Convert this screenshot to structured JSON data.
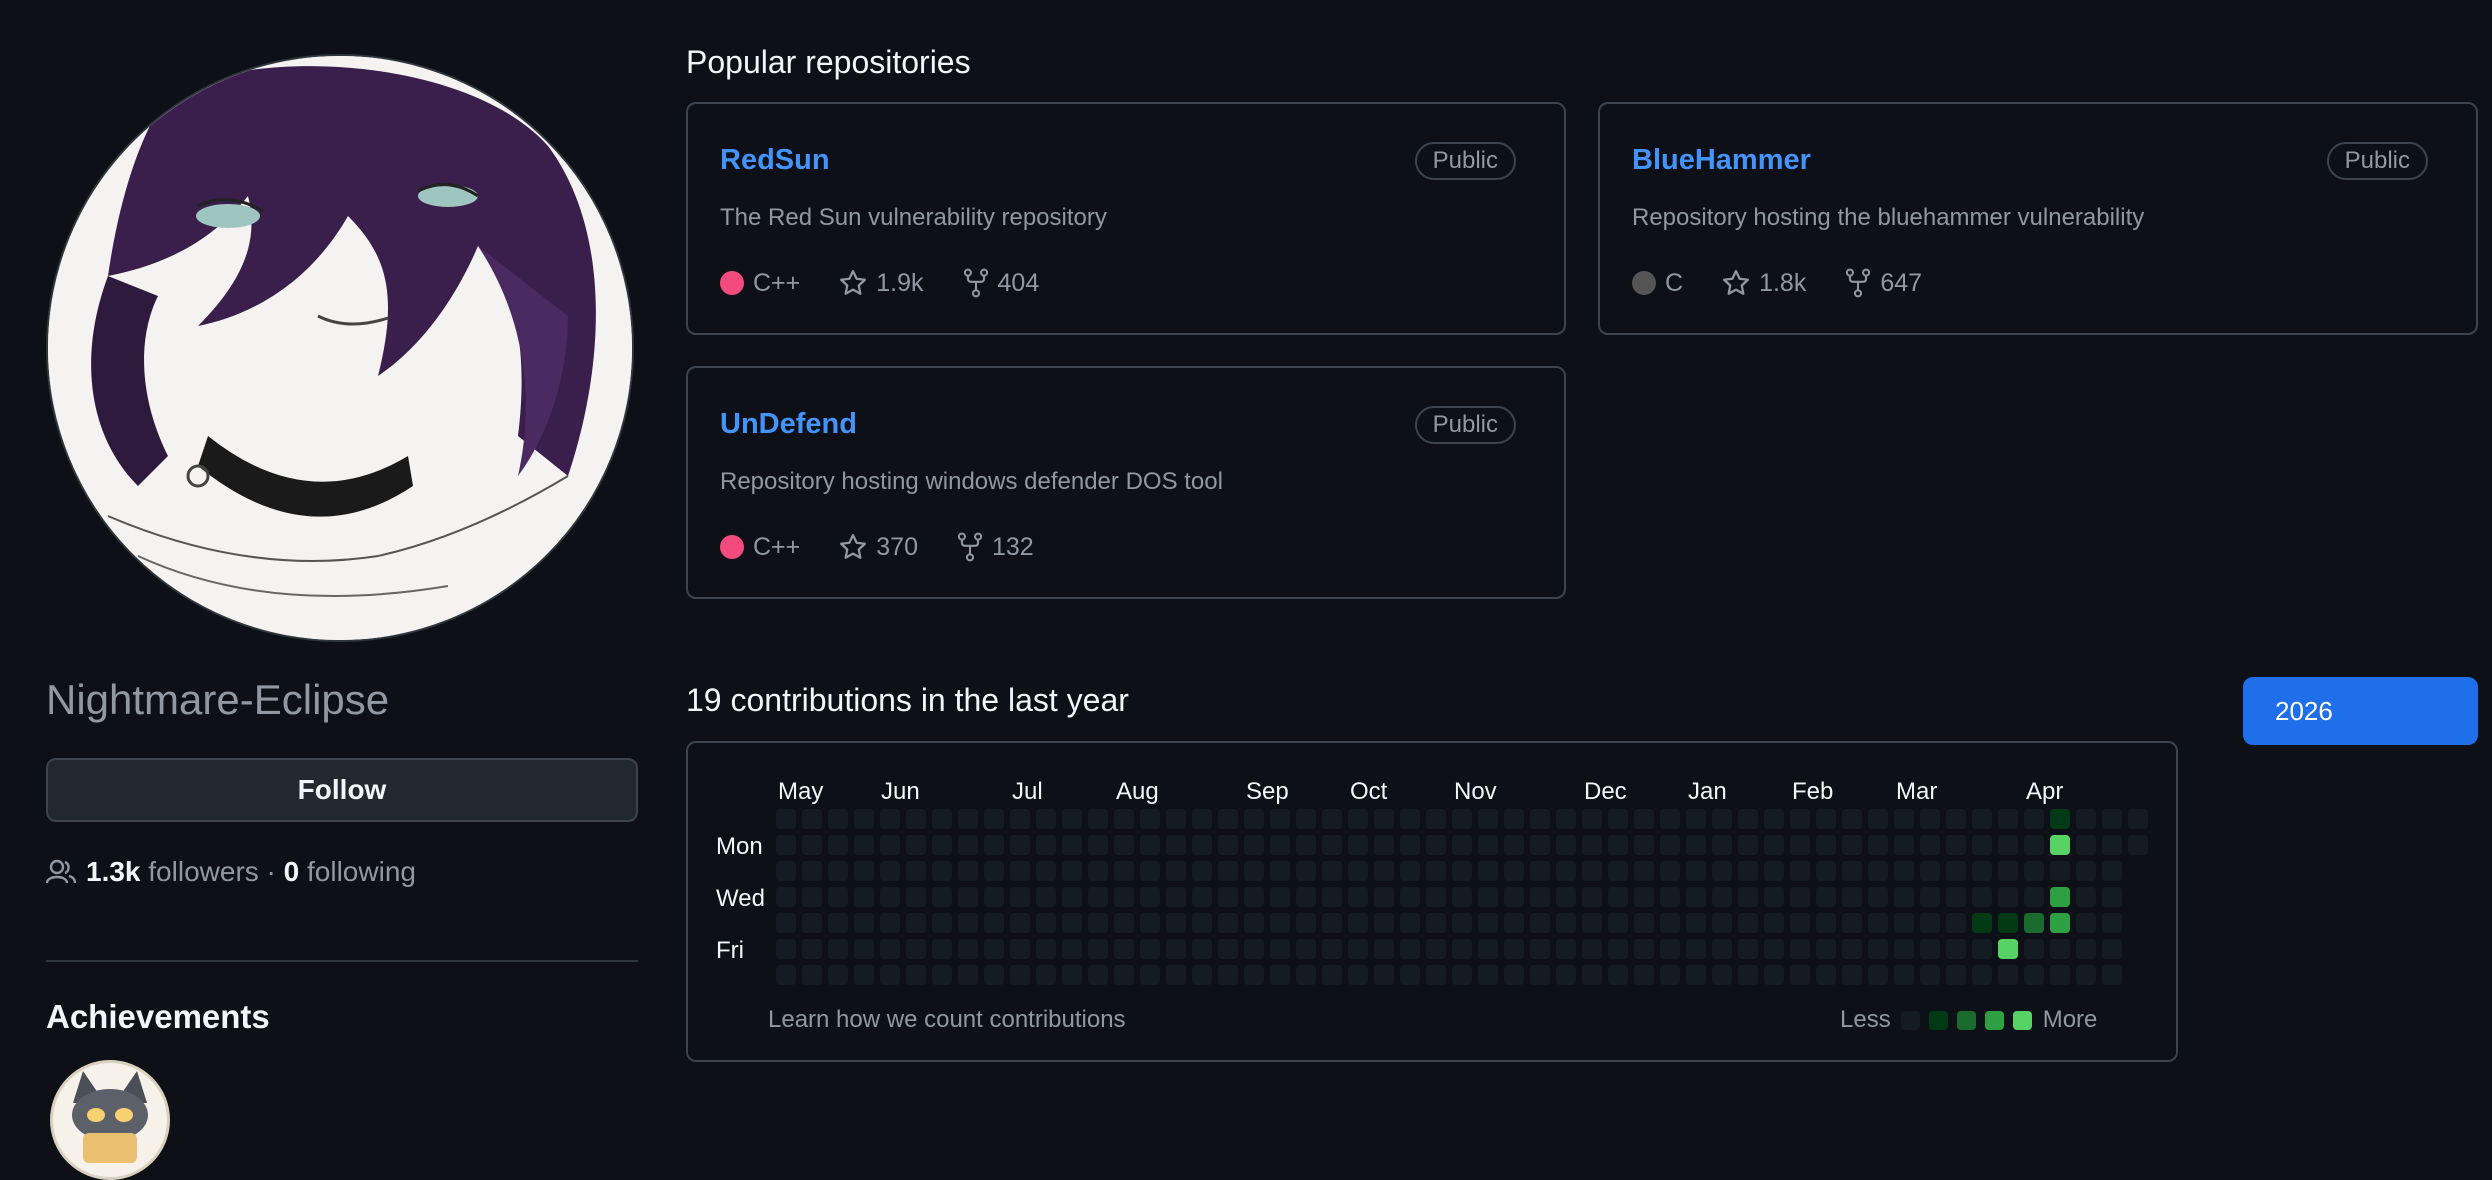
{
  "profile": {
    "display_name": "Nightmare-Eclipse",
    "follow_label": "Follow",
    "followers_count": "1.3k",
    "followers_label": "followers",
    "separator": "·",
    "following_count": "0",
    "following_label": "following",
    "achievements_title": "Achievements"
  },
  "popular": {
    "title": "Popular repositories",
    "repos": [
      {
        "name": "RedSun",
        "visibility": "Public",
        "description": "The Red Sun vulnerability repository",
        "language": "C++",
        "language_color": "#f34b7d",
        "stars": "1.9k",
        "forks": "404"
      },
      {
        "name": "BlueHammer",
        "visibility": "Public",
        "description": "Repository hosting the bluehammer vulnerability",
        "language": "C",
        "language_color": "#555555",
        "stars": "1.8k",
        "forks": "647"
      },
      {
        "name": "UnDefend",
        "visibility": "Public",
        "description": "Repository hosting windows defender DOS tool",
        "language": "C++",
        "language_color": "#f34b7d",
        "stars": "370",
        "forks": "132"
      }
    ]
  },
  "contributions": {
    "title": "19 contributions in the last year",
    "year_button": "2026",
    "months": [
      "May",
      "Jun",
      "Jul",
      "Aug",
      "Sep",
      "Oct",
      "Nov",
      "Dec",
      "Jan",
      "Feb",
      "Mar",
      "Apr"
    ],
    "days": [
      "Mon",
      "Wed",
      "Fri"
    ],
    "weeks": 53,
    "active_cells": [
      {
        "week": 49,
        "day": 0,
        "level": 1
      },
      {
        "week": 49,
        "day": 1,
        "level": 4
      },
      {
        "week": 49,
        "day": 3,
        "level": 3
      },
      {
        "week": 46,
        "day": 4,
        "level": 1
      },
      {
        "week": 47,
        "day": 4,
        "level": 1
      },
      {
        "week": 48,
        "day": 4,
        "level": 2
      },
      {
        "week": 49,
        "day": 4,
        "level": 3
      },
      {
        "week": 47,
        "day": 5,
        "level": 4
      }
    ],
    "learn_link": "Learn how we count contributions",
    "legend_less": "Less",
    "legend_more": "More",
    "level_colors": [
      "#151b23",
      "#033a16",
      "#196c2e",
      "#2ea043",
      "#56d364"
    ]
  }
}
